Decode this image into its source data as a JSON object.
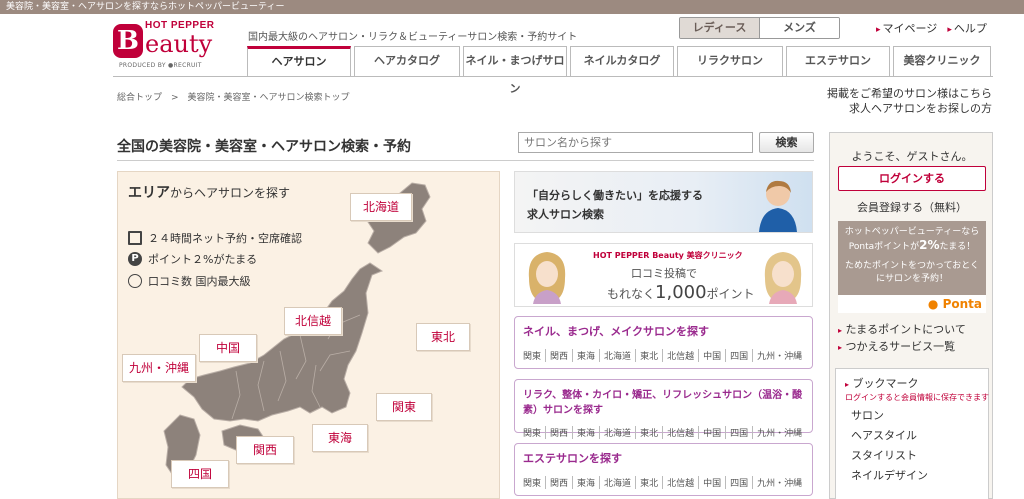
{
  "topbar": "美容院・美容室・ヘアサロンを探すならホットペッパービューティー",
  "logo": {
    "hotpepper": "HOT PEPPER",
    "b": "B",
    "word": "eauty",
    "produced": "PRODUCED BY ●RECRUIT"
  },
  "tagline": "国内最大級のヘアサロン・リラク＆ビューティーサロン検索・予約サイト",
  "gender": {
    "ladies": "レディース",
    "mens": "メンズ"
  },
  "toplinks": {
    "mypage": "マイページ",
    "help": "ヘルプ"
  },
  "tabs": [
    "ヘアサロン",
    "ヘアカタログ",
    "ネイル・まつげサロン",
    "ネイルカタログ",
    "リラクサロン",
    "エステサロン",
    "美容クリニック"
  ],
  "breadcrumb": "総合トップ　>　美容院・美容室・ヘアサロン検索トップ",
  "rightlinks": {
    "line1": "掲載をご希望のサロン様はこちら",
    "line2": "求人ヘアサロンをお探しの方"
  },
  "main_title": "全国の美容院・美容室・ヘアサロン検索・予約",
  "search": {
    "placeholder": "サロン名から探す",
    "button": "検索"
  },
  "area": {
    "title_bold": "エリア",
    "title_rest": "からヘアサロンを探す",
    "features": [
      "２４時間ネット予約・空席確認",
      "ポイント２%がたまる",
      "口コミ数 国内最大級"
    ],
    "regions": {
      "hokkaido": "北海道",
      "tohoku": "東北",
      "hokushinetsu": "北信越",
      "kanto": "関東",
      "tokai": "東海",
      "kansai": "関西",
      "chugoku": "中国",
      "shikoku": "四国",
      "kyushu": "九州・沖縄"
    }
  },
  "banner1": {
    "line1": "「自分らしく働きたい」を応援する",
    "line2": "求人サロン検索"
  },
  "banner2": {
    "brand": "HOT PEPPER Beauty 美容クリニック",
    "line1": "口コミ投稿で",
    "line2a": "もれなく",
    "line2b": "1,000",
    "line2c": "ポイント"
  },
  "salon_boxes": [
    {
      "title": "ネイル、まつげ、メイクサロンを探す",
      "regions": [
        "関東",
        "関西",
        "東海",
        "北海道",
        "東北",
        "北信越",
        "中国",
        "四国",
        "九州・沖縄"
      ]
    },
    {
      "title": "リラク、整体・カイロ・矯正、リフレッシュサロン（温浴・酸素）サロンを探す",
      "regions": [
        "関東",
        "関西",
        "東海",
        "北海道",
        "東北",
        "北信越",
        "中国",
        "四国",
        "九州・沖縄"
      ]
    },
    {
      "title": "エステサロンを探す",
      "regions": [
        "関東",
        "関西",
        "東海",
        "北海道",
        "東北",
        "北信越",
        "中国",
        "四国",
        "九州・沖縄"
      ]
    }
  ],
  "sidebar": {
    "welcome": "ようこそ、ゲストさん。",
    "login": "ログインする",
    "register": "会員登録する（無料）",
    "ponta": {
      "l1": "ホットペッパービューティーなら",
      "l2a": "Pontaポイントが",
      "l2b": "2%",
      "l2c": "たまる！",
      "l3": "ためたポイントをつかっておとく",
      "l4": "にサロンを予約！",
      "logo": "Ponta"
    },
    "links": [
      "たまるポイントについて",
      "つかえるサービス一覧"
    ],
    "bookmark": {
      "title": "ブックマーク",
      "note": "ログインすると会員情報に保存できます",
      "items": [
        "サロン",
        "ヘアスタイル",
        "スタイリスト",
        "ネイルデザイン"
      ]
    }
  }
}
